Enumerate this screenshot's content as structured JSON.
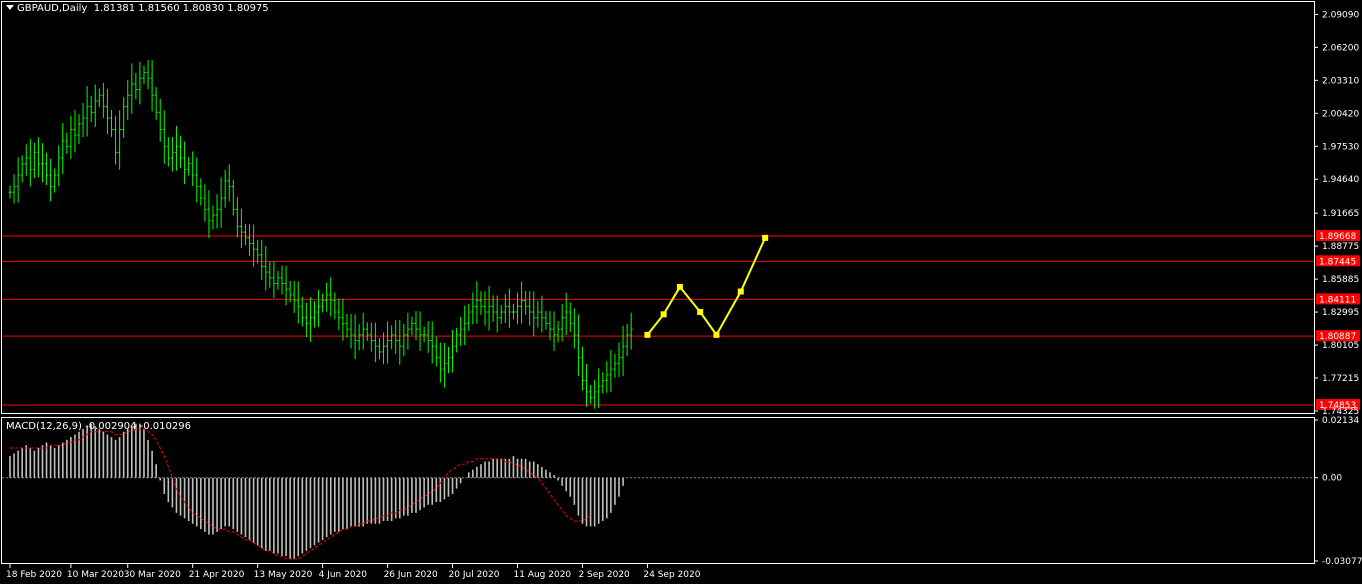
{
  "window": {
    "symbol": "GBPAUD,Daily",
    "ohlc": "1.81381 1.81560 1.80830 1.80975",
    "macd_label": "MACD(12,26,9) -0.002904 -0.010296"
  },
  "colors": {
    "background": "#000000",
    "candle": "#00ff00",
    "level_line": "#ff0000",
    "level_tag": "#ff0000",
    "forecast": "#ffff00",
    "macd_hist": "#c0c0c0",
    "macd_signal": "#ff0000",
    "axis": "#ffffff"
  },
  "chart_data": [
    {
      "type": "candlestick",
      "title": "GBPAUD,Daily",
      "ylim": [
        1.74325,
        2.1
      ],
      "y_ticks": [
        "2.09090",
        "2.06200",
        "2.03310",
        "2.00420",
        "1.97530",
        "1.94640",
        "1.91665",
        "1.88775",
        "1.85885",
        "1.82995",
        "1.80105",
        "1.77215",
        "1.74325"
      ],
      "y_tick_values": [
        2.0909,
        2.062,
        2.0331,
        2.0042,
        1.9753,
        1.9464,
        1.91665,
        1.88775,
        1.85885,
        1.82995,
        1.80105,
        1.77215,
        1.74325
      ],
      "x_ticks": [
        "18 Feb 2020",
        "10 Mar 2020",
        "30 Mar 2020",
        "21 Apr 2020",
        "13 May 2020",
        "4 Jun 2020",
        "26 Jun 2020",
        "20 Jul 2020",
        "11 Aug 2020",
        "2 Sep 2020",
        "24 Sep 2020"
      ],
      "x_tick_index": [
        0,
        15,
        29,
        45,
        61,
        77,
        93,
        109,
        125,
        141,
        157
      ],
      "levels": [
        {
          "value": 1.89668,
          "label": "1.89668"
        },
        {
          "value": 1.87445,
          "label": "1.87445"
        },
        {
          "value": 1.84111,
          "label": "1.84111"
        },
        {
          "value": 1.80887,
          "label": "1.80887"
        },
        {
          "value": 1.74853,
          "label": "1.74853"
        }
      ],
      "close_path": [
        1.935,
        1.94,
        1.95,
        1.96,
        1.965,
        1.955,
        1.97,
        1.96,
        1.96,
        1.95,
        1.94,
        1.95,
        1.965,
        1.98,
        1.975,
        1.99,
        1.985,
        1.995,
        2.0,
        2.01,
        2.005,
        2.015,
        2.02,
        2.01,
        2.0,
        1.99,
        1.97,
        1.99,
        2.01,
        2.02,
        2.03,
        2.025,
        2.035,
        2.04,
        2.035,
        2.02,
        2.005,
        1.99,
        1.975,
        1.965,
        1.97,
        1.975,
        1.965,
        1.955,
        1.96,
        1.95,
        1.94,
        1.93,
        1.92,
        1.91,
        1.915,
        1.92,
        1.93,
        1.945,
        1.94,
        1.92,
        1.905,
        1.9,
        1.895,
        1.89,
        1.885,
        1.88,
        1.87,
        1.865,
        1.86,
        1.855,
        1.86,
        1.855,
        1.85,
        1.845,
        1.84,
        1.835,
        1.825,
        1.82,
        1.825,
        1.83,
        1.835,
        1.84,
        1.845,
        1.84,
        1.83,
        1.825,
        1.82,
        1.815,
        1.81,
        1.805,
        1.81,
        1.815,
        1.81,
        1.805,
        1.8,
        1.795,
        1.8,
        1.805,
        1.81,
        1.805,
        1.8,
        1.81,
        1.815,
        1.82,
        1.815,
        1.81,
        1.81,
        1.805,
        1.8,
        1.79,
        1.78,
        1.785,
        1.79,
        1.8,
        1.81,
        1.815,
        1.82,
        1.83,
        1.835,
        1.84,
        1.835,
        1.83,
        1.835,
        1.83,
        1.825,
        1.83,
        1.835,
        1.83,
        1.83,
        1.835,
        1.84,
        1.835,
        1.83,
        1.825,
        1.83,
        1.825,
        1.82,
        1.815,
        1.81,
        1.815,
        1.825,
        1.83,
        1.82,
        1.81,
        1.79,
        1.77,
        1.76,
        1.755,
        1.76,
        1.765,
        1.77,
        1.775,
        1.78,
        1.785,
        1.79,
        1.8,
        1.81,
        1.815
      ]
    },
    {
      "type": "line",
      "series": [
        {
          "name": "forecast",
          "points": [
            [
              157,
              1.81
            ],
            [
              161,
              1.828
            ],
            [
              165,
              1.852
            ],
            [
              170,
              1.83
            ],
            [
              174,
              1.81
            ],
            [
              180,
              1.848
            ],
            [
              186,
              1.895
            ]
          ]
        }
      ]
    },
    {
      "type": "macd",
      "title": "MACD(12,26,9) -0.002904 -0.010296",
      "ylim": [
        -0.030776,
        0.02134
      ],
      "y_ticks": [
        "0.02134",
        "0.00",
        "-0.030776"
      ],
      "y_tick_values": [
        0.02134,
        0.0,
        -0.030776
      ],
      "histogram": [
        0.008,
        0.009,
        0.01,
        0.011,
        0.012,
        0.011,
        0.01,
        0.011,
        0.012,
        0.013,
        0.012,
        0.011,
        0.012,
        0.013,
        0.014,
        0.015,
        0.016,
        0.017,
        0.018,
        0.019,
        0.02,
        0.019,
        0.018,
        0.017,
        0.016,
        0.015,
        0.014,
        0.015,
        0.017,
        0.018,
        0.019,
        0.02,
        0.02,
        0.018,
        0.014,
        0.01,
        0.005,
        -0.001,
        -0.006,
        -0.009,
        -0.011,
        -0.013,
        -0.014,
        -0.015,
        -0.016,
        -0.017,
        -0.018,
        -0.019,
        -0.02,
        -0.021,
        -0.021,
        -0.02,
        -0.019,
        -0.018,
        -0.018,
        -0.019,
        -0.02,
        -0.021,
        -0.022,
        -0.023,
        -0.024,
        -0.025,
        -0.026,
        -0.027,
        -0.027,
        -0.028,
        -0.028,
        -0.029,
        -0.029,
        -0.03,
        -0.03,
        -0.029,
        -0.028,
        -0.027,
        -0.026,
        -0.025,
        -0.024,
        -0.023,
        -0.022,
        -0.021,
        -0.02,
        -0.02,
        -0.019,
        -0.019,
        -0.018,
        -0.018,
        -0.018,
        -0.018,
        -0.017,
        -0.017,
        -0.017,
        -0.017,
        -0.016,
        -0.016,
        -0.016,
        -0.015,
        -0.015,
        -0.014,
        -0.014,
        -0.013,
        -0.013,
        -0.012,
        -0.011,
        -0.01,
        -0.01,
        -0.009,
        -0.009,
        -0.008,
        -0.007,
        -0.006,
        -0.004,
        -0.002,
        0.0,
        0.002,
        0.003,
        0.004,
        0.005,
        0.006,
        0.006,
        0.007,
        0.007,
        0.007,
        0.007,
        0.007,
        0.008,
        0.007,
        0.007,
        0.007,
        0.006,
        0.006,
        0.005,
        0.004,
        0.003,
        0.002,
        0.001,
        -0.001,
        -0.003,
        -0.005,
        -0.007,
        -0.01,
        -0.014,
        -0.017,
        -0.018,
        -0.018,
        -0.018,
        -0.017,
        -0.016,
        -0.015,
        -0.013,
        -0.01,
        -0.007,
        -0.003
      ],
      "signal": [
        0.011,
        0.011,
        0.011,
        0.011,
        0.011,
        0.011,
        0.011,
        0.011,
        0.011,
        0.011,
        0.012,
        0.012,
        0.012,
        0.012,
        0.013,
        0.013,
        0.014,
        0.014,
        0.015,
        0.016,
        0.017,
        0.017,
        0.017,
        0.017,
        0.017,
        0.017,
        0.016,
        0.016,
        0.016,
        0.017,
        0.017,
        0.018,
        0.018,
        0.018,
        0.017,
        0.016,
        0.014,
        0.011,
        0.008,
        0.004,
        0.0,
        -0.004,
        -0.007,
        -0.009,
        -0.011,
        -0.013,
        -0.014,
        -0.015,
        -0.016,
        -0.017,
        -0.018,
        -0.019,
        -0.019,
        -0.019,
        -0.02,
        -0.02,
        -0.021,
        -0.022,
        -0.023,
        -0.023,
        -0.024,
        -0.025,
        -0.026,
        -0.027,
        -0.027,
        -0.028,
        -0.029,
        -0.029,
        -0.03,
        -0.03,
        -0.03,
        -0.03,
        -0.029,
        -0.028,
        -0.027,
        -0.026,
        -0.025,
        -0.024,
        -0.023,
        -0.022,
        -0.021,
        -0.02,
        -0.019,
        -0.019,
        -0.018,
        -0.018,
        -0.017,
        -0.017,
        -0.016,
        -0.016,
        -0.015,
        -0.015,
        -0.014,
        -0.014,
        -0.013,
        -0.013,
        -0.012,
        -0.012,
        -0.011,
        -0.01,
        -0.009,
        -0.008,
        -0.007,
        -0.006,
        -0.005,
        -0.004,
        -0.002,
        0.0,
        0.002,
        0.003,
        0.004,
        0.005,
        0.005,
        0.006,
        0.006,
        0.007,
        0.007,
        0.007,
        0.007,
        0.007,
        0.007,
        0.007,
        0.006,
        0.006,
        0.005,
        0.005,
        0.004,
        0.003,
        0.002,
        0.001,
        0.0,
        -0.002,
        -0.004,
        -0.006,
        -0.008,
        -0.01,
        -0.012,
        -0.014,
        -0.015,
        -0.016,
        -0.016,
        -0.016,
        -0.015,
        -0.014
      ]
    }
  ]
}
